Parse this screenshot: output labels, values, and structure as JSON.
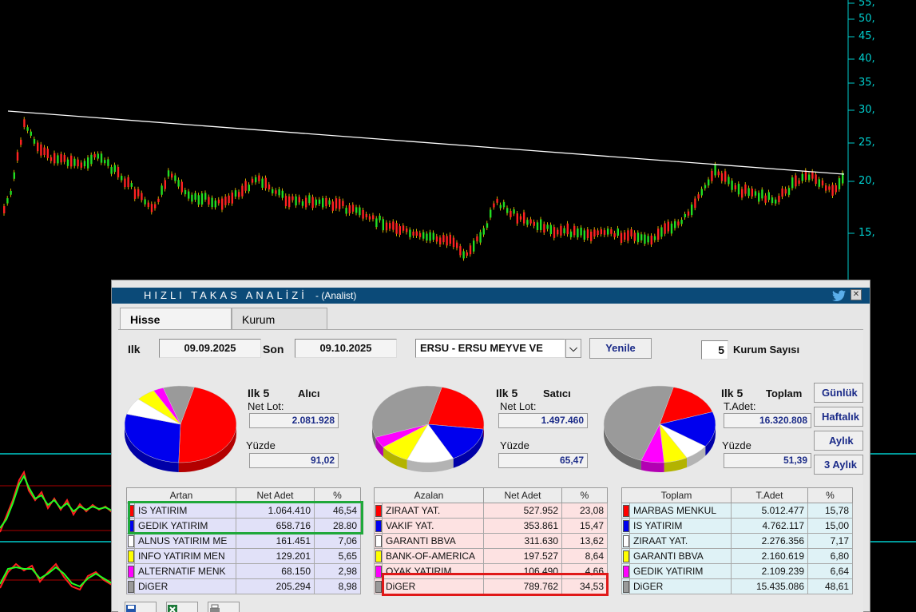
{
  "colors": {
    "red": "#ff0000",
    "blue": "#0000ee",
    "white": "#ffffff",
    "yellow": "#ffff00",
    "magenta": "#ff00ff",
    "gray": "#9a9a9a",
    "artan_bg": "#e1e1f8",
    "azalan_bg": "#fde2e2",
    "toplam_bg": "#dff2f6",
    "axis": "#00cccc"
  },
  "price_axis": {
    "ticks": [
      "55,",
      "50,",
      "45,",
      "40,",
      "35,",
      "30,",
      "25,",
      "20,",
      "15,"
    ]
  },
  "window": {
    "title": "HIZLI TAKAS ANALİZİ",
    "subtitle": "- (Analist)",
    "twitter_icon": "twitter-icon",
    "close_icon": "close-icon"
  },
  "tabs": [
    {
      "label": "Hisse"
    },
    {
      "label": "Kurum"
    }
  ],
  "controls": {
    "start_label": "Ilk",
    "start_date": "09.09.2025",
    "end_label": "Son",
    "end_date": "09.10.2025",
    "symbol": "ERSU - ERSU MEYVE VE",
    "refresh": "Yenile",
    "count_value": "5",
    "count_label": "Kurum Sayısı"
  },
  "period_buttons": [
    "Günlük",
    "Haftalık",
    "Aylık",
    "3 Aylık"
  ],
  "summaries": [
    {
      "ilk": "Ilk 5",
      "kind": "Alıcı",
      "lot_label": "Net Lot:",
      "lot": "2.081.928",
      "pct_label": "Yüzde",
      "pct": "91,02"
    },
    {
      "ilk": "Ilk 5",
      "kind": "Satıcı",
      "lot_label": "Net Lot:",
      "lot": "1.497.460",
      "pct_label": "Yüzde",
      "pct": "65,47"
    },
    {
      "ilk": "Ilk 5",
      "kind": "Toplam",
      "lot_label": "T.Adet:",
      "lot": "16.320.808",
      "pct_label": "Yüzde",
      "pct": "51,39"
    }
  ],
  "pies": [
    {
      "slices": [
        46.54,
        28.8,
        7.06,
        5.65,
        2.98,
        8.98
      ],
      "colors": [
        "#ff0000",
        "#0000ee",
        "#ffffff",
        "#ffff00",
        "#ff00ff",
        "#9a9a9a"
      ]
    },
    {
      "slices": [
        23.08,
        15.47,
        13.62,
        8.64,
        4.66,
        34.53
      ],
      "colors": [
        "#ff0000",
        "#0000ee",
        "#ffffff",
        "#ffff00",
        "#ff00ff",
        "#9a9a9a"
      ]
    },
    {
      "slices": [
        15.78,
        15.0,
        7.17,
        6.8,
        6.64,
        48.61
      ],
      "colors": [
        "#ff0000",
        "#0000ee",
        "#ffffff",
        "#ffff00",
        "#ff00ff",
        "#9a9a9a"
      ]
    }
  ],
  "tables": [
    {
      "headers": [
        "Artan",
        "Net Adet",
        "%"
      ],
      "rows": [
        {
          "name": "IS YATIRIM",
          "value": "1.064.410",
          "pct": "46,54",
          "color": "#ff0000"
        },
        {
          "name": "GEDIK YATIRIM",
          "value": "658.716",
          "pct": "28.80",
          "color": "#0000ee"
        },
        {
          "name": "ALNUS YATIRIM ME",
          "value": "161.451",
          "pct": "7,06",
          "color": "#ffffff"
        },
        {
          "name": "INFO YATIRIM MEN",
          "value": "129.201",
          "pct": "5,65",
          "color": "#ffff00"
        },
        {
          "name": "ALTERNATIF MENK",
          "value": "68.150",
          "pct": "2,98",
          "color": "#ff00ff"
        },
        {
          "name": "DiGER",
          "value": "205.294",
          "pct": "8,98",
          "color": "#9a9a9a"
        }
      ]
    },
    {
      "headers": [
        "Azalan",
        "Net Adet",
        "%"
      ],
      "rows": [
        {
          "name": "ZIRAAT YAT.",
          "value": "527.952",
          "pct": "23,08",
          "color": "#ff0000"
        },
        {
          "name": "VAKIF YAT.",
          "value": "353.861",
          "pct": "15,47",
          "color": "#0000ee"
        },
        {
          "name": "GARANTI BBVA",
          "value": "311.630",
          "pct": "13,62",
          "color": "#ffffff"
        },
        {
          "name": "BANK-OF-AMERICA",
          "value": "197.527",
          "pct": "8,64",
          "color": "#ffff00"
        },
        {
          "name": "OYAK YATIRIM",
          "value": "106.490",
          "pct": "4,66",
          "color": "#ff00ff"
        },
        {
          "name": "DiGER",
          "value": "789.762",
          "pct": "34,53",
          "color": "#9a9a9a"
        }
      ]
    },
    {
      "headers": [
        "Toplam",
        "T.Adet",
        "%"
      ],
      "rows": [
        {
          "name": "MARBAS MENKUL",
          "value": "5.012.477",
          "pct": "15,78",
          "color": "#ff0000"
        },
        {
          "name": "IS YATIRIM",
          "value": "4.762.117",
          "pct": "15,00",
          "color": "#0000ee"
        },
        {
          "name": "ZIRAAT YAT.",
          "value": "2.276.356",
          "pct": "7,17",
          "color": "#ffffff"
        },
        {
          "name": "GARANTI BBVA",
          "value": "2.160.619",
          "pct": "6,80",
          "color": "#ffff00"
        },
        {
          "name": "GEDIK YATIRIM",
          "value": "2.109.239",
          "pct": "6,64",
          "color": "#ff00ff"
        },
        {
          "name": "DiGER",
          "value": "15.435.086",
          "pct": "48,61",
          "color": "#9a9a9a"
        }
      ]
    }
  ],
  "bottom_icons": [
    "save-icon",
    "excel-icon",
    "print-icon"
  ]
}
